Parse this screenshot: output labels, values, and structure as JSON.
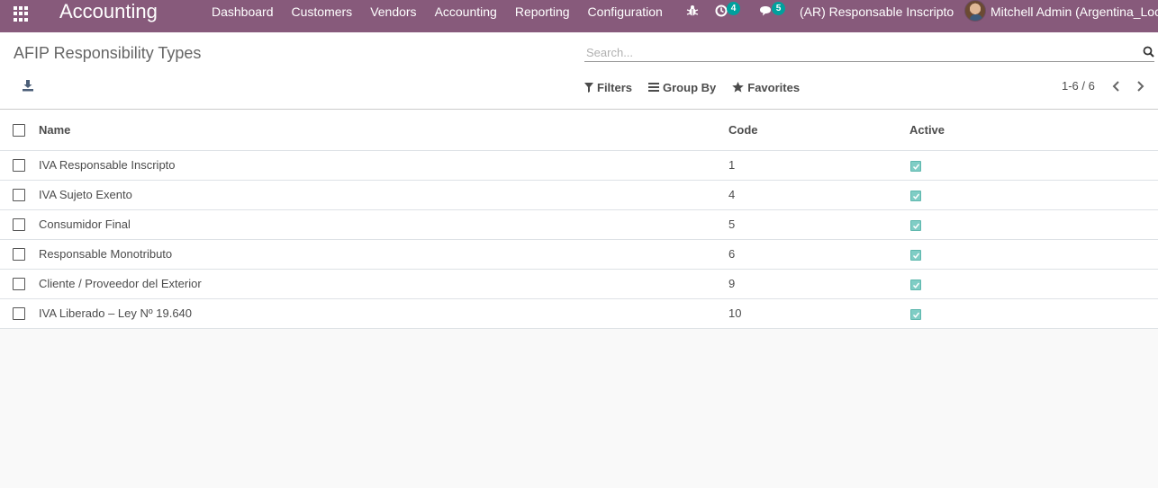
{
  "navbar": {
    "app_title": "Accounting",
    "menu": [
      "Dashboard",
      "Customers",
      "Vendors",
      "Accounting",
      "Reporting",
      "Configuration"
    ],
    "activity_count": "4",
    "messages_count": "5",
    "company": "(AR) Responsable Inscripto",
    "user": "Mitchell Admin (Argentina_Loc)"
  },
  "control_panel": {
    "title": "AFIP Responsibility Types",
    "search_placeholder": "Search...",
    "filters_label": "Filters",
    "group_by_label": "Group By",
    "favorites_label": "Favorites",
    "pager": "1-6 / 6"
  },
  "table": {
    "columns": {
      "name": "Name",
      "code": "Code",
      "active": "Active"
    },
    "rows": [
      {
        "name": "IVA Responsable Inscripto",
        "code": "1",
        "active": true
      },
      {
        "name": "IVA Sujeto Exento",
        "code": "4",
        "active": true
      },
      {
        "name": "Consumidor Final",
        "code": "5",
        "active": true
      },
      {
        "name": "Responsable Monotributo",
        "code": "6",
        "active": true
      },
      {
        "name": "Cliente / Proveedor del Exterior",
        "code": "9",
        "active": true
      },
      {
        "name": "IVA Liberado – Ley Nº 19.640",
        "code": "10",
        "active": true
      }
    ]
  },
  "colors": {
    "navbar": "#875a7b",
    "badge": "#00a09d",
    "active_checkbox": "#7fcdc5"
  },
  "icons": [
    "apps-icon",
    "bug-icon",
    "activity-icon",
    "messages-icon",
    "download-icon",
    "search-icon",
    "filter-icon",
    "group-by-icon",
    "star-icon",
    "chevron-left-icon",
    "chevron-right-icon"
  ]
}
